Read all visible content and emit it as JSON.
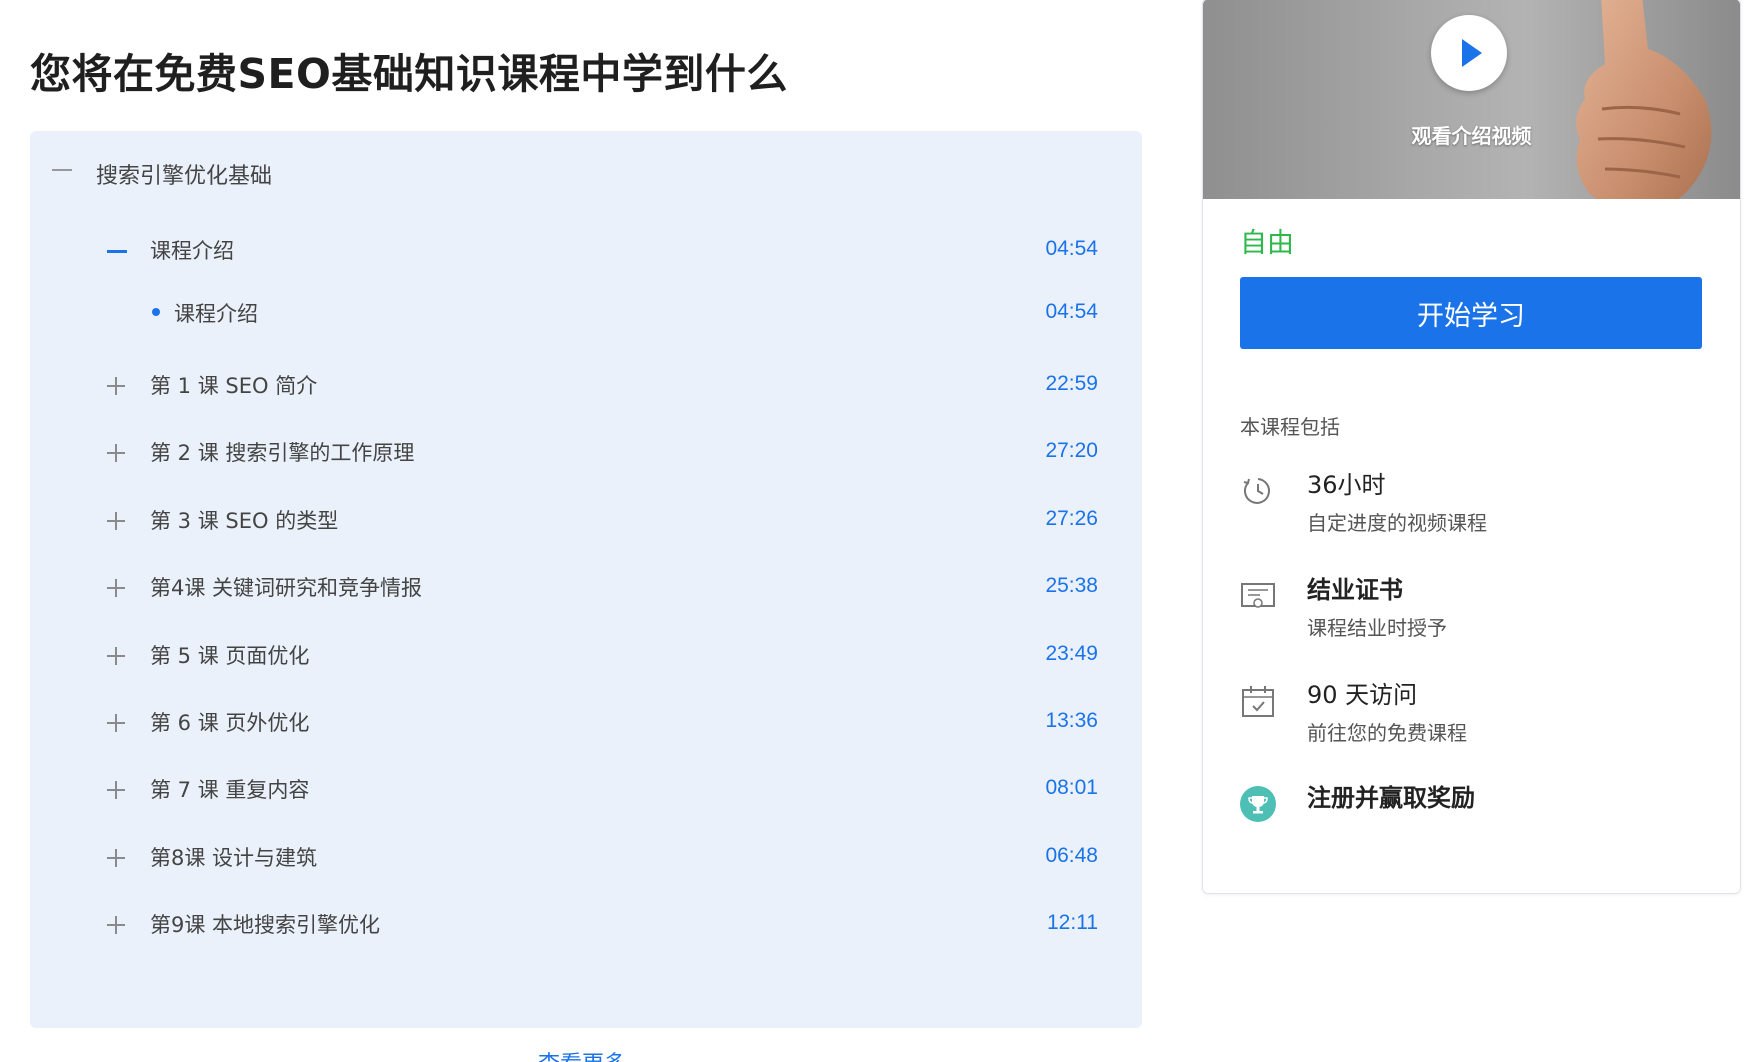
{
  "page_title": "您将在免费SEO基础知识课程中学到什么",
  "module": {
    "title": "搜索引擎优化基础"
  },
  "lessons": [
    {
      "title": "课程介绍",
      "duration": "04:54"
    },
    {
      "title": "课程介绍",
      "duration": "04:54"
    },
    {
      "title": "第 1 课 SEO 简介",
      "duration": "22:59"
    },
    {
      "title": "第 2 课 搜索引擎的工作原理",
      "duration": "27:20"
    },
    {
      "title": "第 3 课 SEO 的类型",
      "duration": "27:26"
    },
    {
      "title": "第4课 关键词研究和竞争情报",
      "duration": "25:38"
    },
    {
      "title": "第 5 课 页面优化",
      "duration": "23:49"
    },
    {
      "title": "第 6 课 页外优化",
      "duration": "13:36"
    },
    {
      "title": "第 7 课 重复内容",
      "duration": "08:01"
    },
    {
      "title": "第8课 设计与建筑",
      "duration": "06:48"
    },
    {
      "title": "第9课 本地搜索引擎优化",
      "duration": "12:11"
    }
  ],
  "see_more": "查看更多",
  "sidebar": {
    "video_caption": "观看介绍视频",
    "price": "自由",
    "start_button": "开始学习",
    "includes_heading": "本课程包括",
    "features": [
      {
        "icon": "clock-icon",
        "title": "36小时",
        "desc": "自定进度的视频课程"
      },
      {
        "icon": "certificate-icon",
        "title": "结业证书",
        "desc": "课程结业时授予"
      },
      {
        "icon": "calendar-icon",
        "title": "90 天访问",
        "desc": "前往您的免费课程"
      },
      {
        "icon": "trophy-icon",
        "title": "注册并赢取奖励",
        "desc": ""
      }
    ]
  },
  "colors": {
    "accent": "#1a73e8",
    "price_green": "#2eb84a",
    "curriculum_bg": "#eaf1fa",
    "trophy_teal": "#4dbfb5"
  }
}
